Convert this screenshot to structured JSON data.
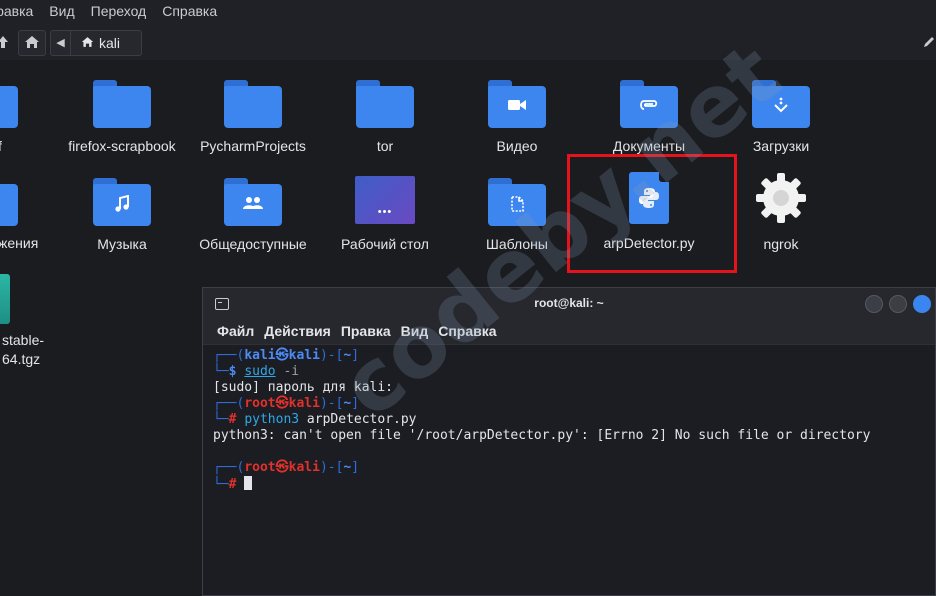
{
  "menubar": {
    "items": [
      "Правка",
      "Вид",
      "Переход",
      "Справка"
    ]
  },
  "toolbar": {
    "location": "kali"
  },
  "files": {
    "row1": [
      {
        "name": "f",
        "partial": true
      },
      {
        "name": "firefox-scrapbook",
        "icon": "folder"
      },
      {
        "name": "PycharmProjects",
        "icon": "folder"
      },
      {
        "name": "tor",
        "icon": "folder"
      },
      {
        "name": "Видео",
        "icon": "folder-video"
      },
      {
        "name": "Документы",
        "icon": "folder-documents"
      },
      {
        "name": "Загрузки",
        "icon": "folder-downloads"
      }
    ],
    "row2": [
      {
        "name": "жения",
        "partial": true
      },
      {
        "name": "Музыка",
        "icon": "folder-music"
      },
      {
        "name": "Общедоступные",
        "icon": "folder-public"
      },
      {
        "name": "Рабочий стол",
        "icon": "desktop"
      },
      {
        "name": "Шаблоны",
        "icon": "folder-templates"
      },
      {
        "name": "arpDetector.py",
        "icon": "python-file",
        "highlighted": true
      },
      {
        "name": "ngrok",
        "icon": "gear"
      }
    ],
    "row3": [
      {
        "name_line1": "stable-",
        "name_line2": "64.tgz",
        "icon": "archive",
        "partial": true
      }
    ]
  },
  "watermark": "codeby.net",
  "terminal": {
    "title": "root@kali: ~",
    "menu": [
      "Файл",
      "Действия",
      "Правка",
      "Вид",
      "Справка"
    ],
    "lines": {
      "l1_prefix": "┌──(",
      "l1_user": "kali㉿kali",
      "l1_mid": ")-[",
      "l1_dir": "~",
      "l1_end": "]",
      "l2_prefix": "└─",
      "l2_prompt": "$",
      "l2_cmd": "sudo",
      "l2_arg": " -i",
      "l3": "[sudo] пароль для kali:",
      "l4_prefix": "┌──(",
      "l4_user": "root㉿kali",
      "l4_mid": ")-[",
      "l4_dir": "~",
      "l4_end": "]",
      "l5_prefix": "└─",
      "l5_prompt": "#",
      "l5_cmd": "python3",
      "l5_arg": " arpDetector.py",
      "l6": "python3: can't open file '/root/arpDetector.py': [Errno 2] No such file or directory",
      "l8_prefix": "┌──(",
      "l8_user": "root㉿kali",
      "l8_mid": ")-[",
      "l8_dir": "~",
      "l8_end": "]",
      "l9_prefix": "└─",
      "l9_prompt": "#"
    }
  }
}
